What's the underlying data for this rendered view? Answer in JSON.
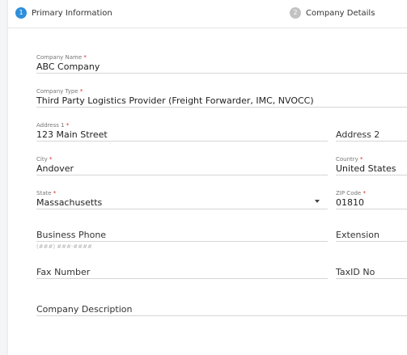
{
  "steps": [
    {
      "number": "1",
      "label": "Primary Information"
    },
    {
      "number": "2",
      "label": "Company Details"
    }
  ],
  "form": {
    "company_name": {
      "label": "Company Name",
      "required": "*",
      "value": "ABC Company"
    },
    "company_type": {
      "label": "Company Type",
      "required": "*",
      "value": "Third Party Logistics Provider (Freight Forwarder, IMC, NVOCC)"
    },
    "address1": {
      "label": "Address 1",
      "required": "*",
      "value": "123 Main Street"
    },
    "address2": {
      "placeholder": "Address 2"
    },
    "city": {
      "label": "City",
      "required": "*",
      "value": "Andover"
    },
    "country": {
      "label": "Country",
      "required": "*",
      "value": "United States"
    },
    "state": {
      "label": "State",
      "required": "*",
      "value": "Massachusetts"
    },
    "zip": {
      "label": "ZIP Code",
      "required": "*",
      "value": "01810"
    },
    "business_phone": {
      "placeholder": "Business Phone",
      "hint": "(###) ###-####"
    },
    "extension": {
      "placeholder": "Extension"
    },
    "fax": {
      "placeholder": "Fax Number"
    },
    "taxid": {
      "placeholder": "TaxID No"
    },
    "description": {
      "placeholder": "Company Description"
    }
  },
  "colors": {
    "accent": "#2e8fdb",
    "required": "#e02020",
    "inactive_step": "#c2c2c2"
  }
}
